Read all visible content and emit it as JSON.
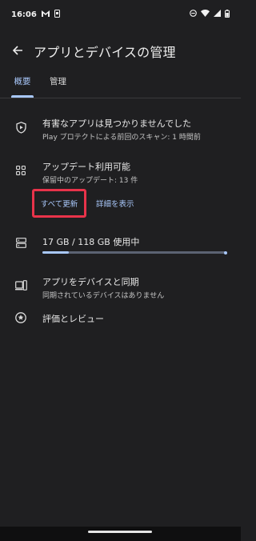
{
  "status_bar": {
    "time": "16:06",
    "icons": [
      "gmail-icon",
      "phone-notification-icon",
      "dnd-icon",
      "wifi-icon",
      "signal-icon",
      "battery-icon"
    ]
  },
  "app_bar": {
    "back_icon": "arrow-back-icon",
    "title": "アプリとデバイスの管理"
  },
  "tabs": [
    {
      "label": "概要",
      "selected": true
    },
    {
      "label": "管理",
      "selected": false
    }
  ],
  "protect": {
    "icon": "play-protect-icon",
    "title": "有害なアプリは見つかりませんでした",
    "subtitle": "Play プロテクトによる前回のスキャン: 1 時間前"
  },
  "updates": {
    "icon": "apps-grid-icon",
    "title": "アップデート利用可能",
    "subtitle": "保留中のアップデート: 13 件",
    "update_all_label": "すべて更新",
    "details_label": "詳細を表示"
  },
  "storage": {
    "icon": "storage-icon",
    "title": "17 GB / 118 GB 使用中",
    "used_fraction": 0.144
  },
  "sync": {
    "icon": "device-sync-icon",
    "title": "アプリをデバイスと同期",
    "subtitle": "同期されているデバイスはありません"
  },
  "ratings": {
    "icon": "star-circle-icon",
    "title": "評価とレビュー"
  },
  "colors": {
    "background": "#1f1f21",
    "accent": "#a8c7fa",
    "highlight_border": "#e8334a"
  }
}
